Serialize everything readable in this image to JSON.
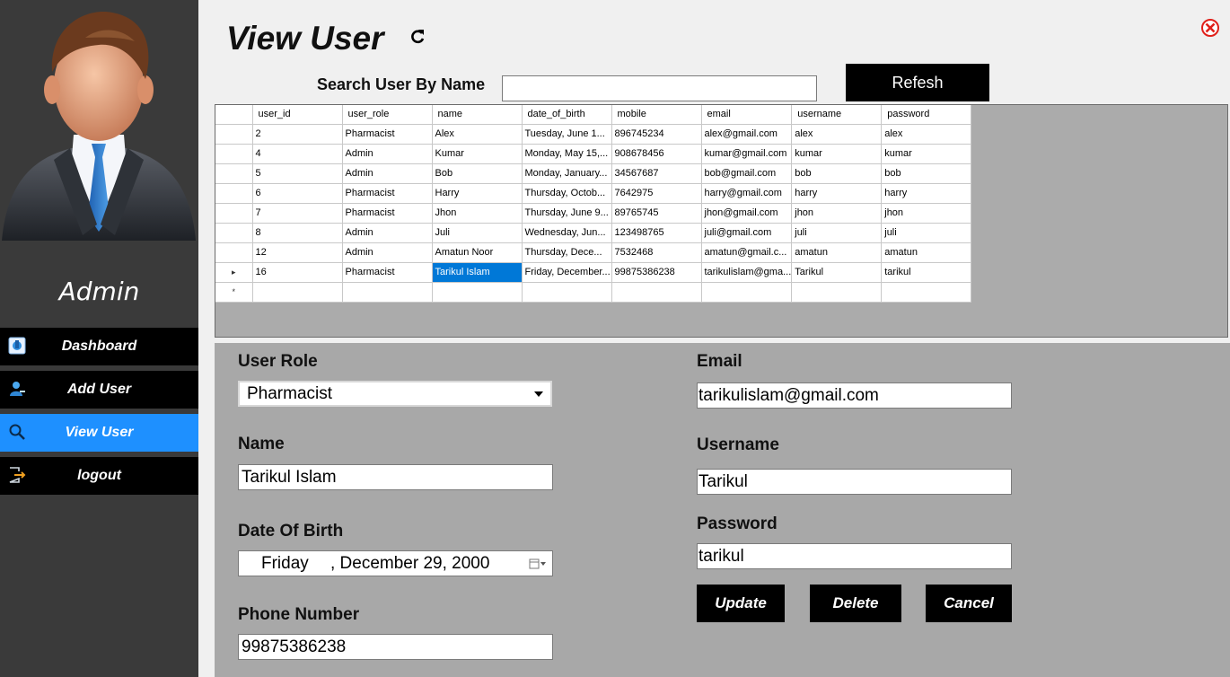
{
  "sidebar": {
    "admin_label": "Admin",
    "items": [
      {
        "label": "Dashboard",
        "icon": "dashboard-icon"
      },
      {
        "label": "Add User",
        "icon": "user-add-icon"
      },
      {
        "label": "View User",
        "icon": "search-icon"
      },
      {
        "label": "logout",
        "icon": "logout-icon"
      }
    ],
    "active_index": 2,
    "active_color": "#1e90ff"
  },
  "header": {
    "title": "View User",
    "search_label": "Search User By Name",
    "search_value": "",
    "refresh_button": "Refesh"
  },
  "grid": {
    "columns": [
      "user_id",
      "user_role",
      "name",
      "date_of_birth",
      "mobile",
      "email",
      "username",
      "password"
    ],
    "rows": [
      [
        "2",
        "Pharmacist",
        "Alex",
        "Tuesday, June 1...",
        "896745234",
        "alex@gmail.com",
        "alex",
        "alex"
      ],
      [
        "4",
        "Admin",
        "Kumar",
        "Monday, May 15,...",
        "908678456",
        "kumar@gmail.com",
        "kumar",
        "kumar"
      ],
      [
        "5",
        "Admin",
        "Bob",
        "Monday, January...",
        "34567687",
        "bob@gmail.com",
        "bob",
        "bob"
      ],
      [
        "6",
        "Pharmacist",
        "Harry",
        "Thursday, Octob...",
        "7642975",
        "harry@gmail.com",
        "harry",
        "harry"
      ],
      [
        "7",
        "Pharmacist",
        "Jhon",
        "Thursday, June 9...",
        "89765745",
        "jhon@gmail.com",
        "jhon",
        "jhon"
      ],
      [
        "8",
        "Admin",
        "Juli",
        "Wednesday, Jun...",
        "123498765",
        "juli@gmail.com",
        "juli",
        "juli"
      ],
      [
        "12",
        "Admin",
        "Amatun Noor",
        "Thursday, Dece...",
        "7532468",
        "amatun@gmail.c...",
        "amatun",
        "amatun"
      ],
      [
        "16",
        "Pharmacist",
        "Tarikul Islam",
        "Friday, December...",
        "99875386238",
        "tarikulislam@gma...",
        "Tarikul",
        "tarikul"
      ]
    ],
    "current_row_marker": "▸",
    "new_row_marker": "*",
    "selected_row": 7,
    "selected_col": 2
  },
  "form": {
    "user_role_label": "User Role",
    "user_role_value": "Pharmacist",
    "name_label": "Name",
    "name_value": "Tarikul Islam",
    "dob_label": "Date Of Birth",
    "dob_day": "Friday",
    "dob_date": ", December 29, 2000",
    "phone_label": "Phone Number",
    "phone_value": "99875386238",
    "email_label": "Email",
    "email_value": "tarikulislam@gmail.com",
    "username_label": "Username",
    "username_value": "Tarikul",
    "password_label": "Password",
    "password_value": "tarikul",
    "update_button": "Update",
    "delete_button": "Delete",
    "cancel_button": "Cancel"
  }
}
